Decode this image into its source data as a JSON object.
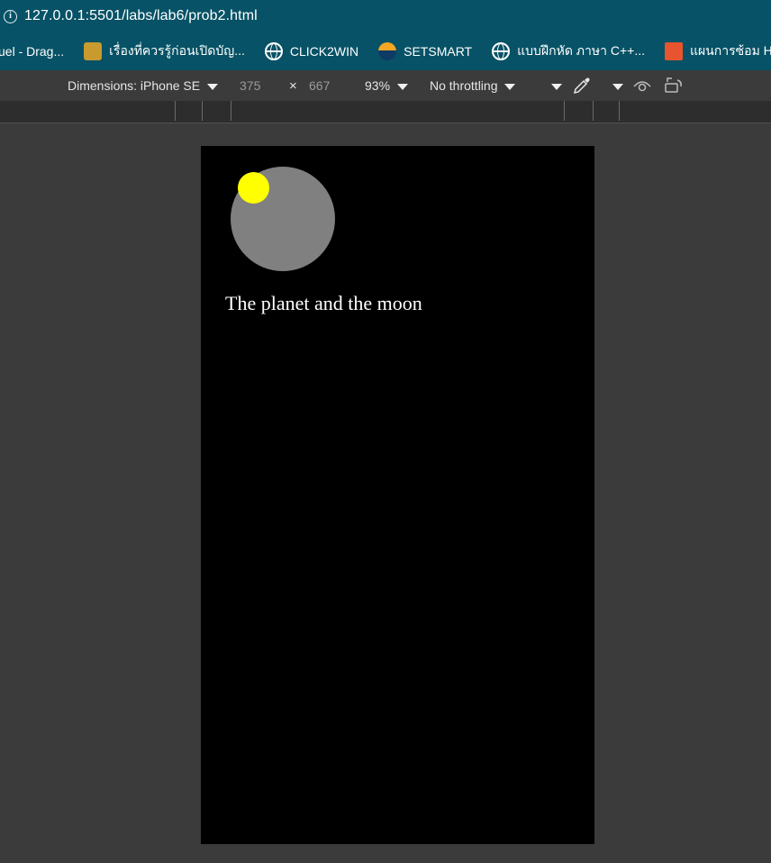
{
  "browser": {
    "url": "127.0.0.1:5501/labs/lab6/prob2.html",
    "info_icon": "info-icon"
  },
  "bookmarks": [
    {
      "label": "uel - Drag...",
      "icon": "none"
    },
    {
      "label": "เรื่องที่ควรรู้ก่อนเปิดบัญ...",
      "icon": "bank-logo-icon"
    },
    {
      "label": "CLICK2WIN",
      "icon": "globe-icon"
    },
    {
      "label": "SETSMART",
      "icon": "setsmart-logo-icon"
    },
    {
      "label": "แบบฝึกหัด ภาษา C++...",
      "icon": "globe-icon"
    },
    {
      "label": "แผนการซ้อม Hal",
      "icon": "orange-logo-icon"
    }
  ],
  "devtools": {
    "dimensions_label": "Dimensions: iPhone SE",
    "width": "375",
    "times": "×",
    "height": "667",
    "zoom": "93%",
    "throttling": "No throttling"
  },
  "page": {
    "background": "#000000",
    "planet_color": "#808080",
    "moon_color": "#ffff00",
    "caption": "The planet and the moon"
  }
}
